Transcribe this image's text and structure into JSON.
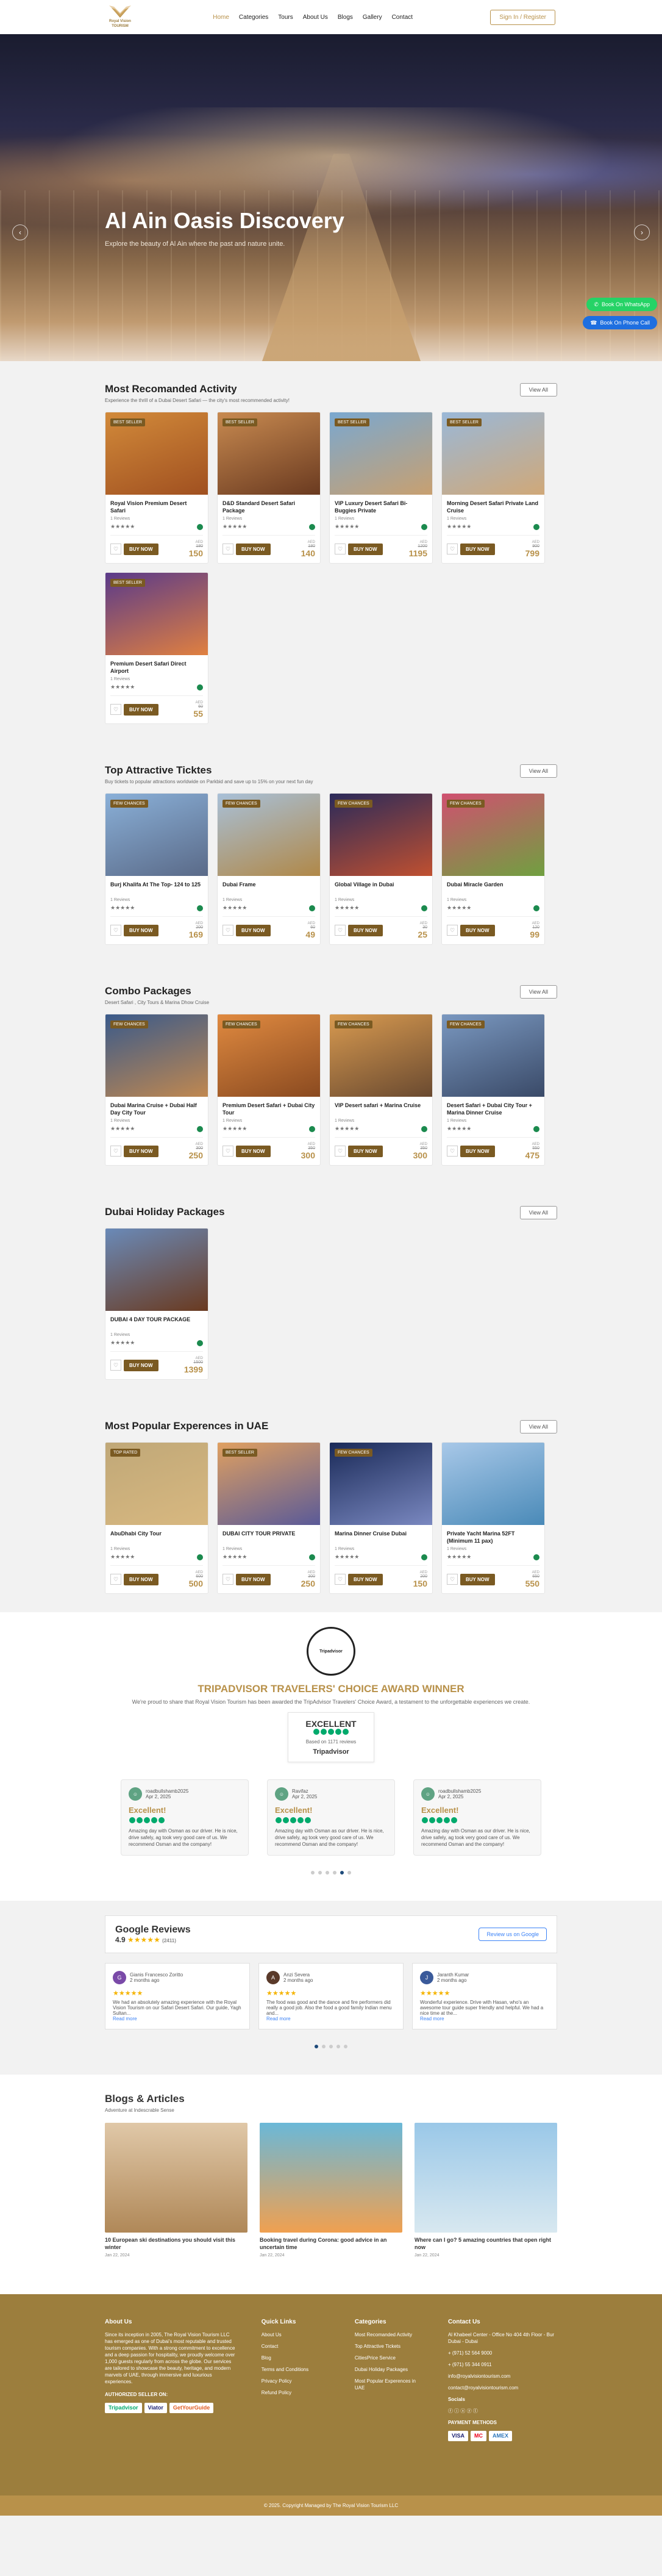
{
  "header": {
    "logo_line1": "Royal Vision",
    "logo_line2": "TOURISM",
    "nav": [
      "Home",
      "Categories",
      "Tours",
      "About Us",
      "Blogs",
      "Gallery",
      "Contact"
    ],
    "signin": "Sign In / Register"
  },
  "hero": {
    "title": "Al Ain Oasis Discovery",
    "subtitle": "Explore the beauty of Al Ain where the past and nature unite.",
    "whatsapp": "Book On WhatsApp",
    "phone": "Book On Phone Call"
  },
  "view_all": "View All",
  "buy": "BUY NOW",
  "aed": "AED",
  "sections": [
    {
      "title": "Most Recomanded Activity",
      "subtitle": "Experience the thrill of a Dubai Desert Safari — the city's most recommended activity!",
      "cards": [
        {
          "badge": "BEST SELLER",
          "title": "Royal Vision Premium Desert Safari",
          "reviews": "1 Reviews",
          "old": "180",
          "price": "150",
          "colors": [
            "#d28a3a",
            "#a05020"
          ]
        },
        {
          "badge": "BEST SELLER",
          "title": "D&D Standard Desert Safari Package",
          "reviews": "1 Reviews",
          "old": "180",
          "price": "140",
          "colors": [
            "#c88a50",
            "#6a3a20"
          ]
        },
        {
          "badge": "BEST SELLER",
          "title": "VIP Luxury Desert Safari Bi-Buggies Private",
          "reviews": "1 Reviews",
          "old": "1200",
          "price": "1195",
          "colors": [
            "#7aa8d0",
            "#c8a070"
          ]
        },
        {
          "badge": "BEST SELLER",
          "title": "Morning Desert Safari Private Land Cruise",
          "reviews": "1 Reviews",
          "old": "900",
          "price": "799",
          "colors": [
            "#9ab8d8",
            "#d0a878"
          ]
        },
        {
          "badge": "BEST SELLER",
          "title": "Premium Desert Safari Direct Airport",
          "reviews": "1 Reviews",
          "old": "60",
          "price": "55",
          "colors": [
            "#5a3a8a",
            "#e08040"
          ]
        }
      ]
    },
    {
      "title": "Top Attractive Ticktes",
      "subtitle": "Buy tickets to popular attractions worldwide on Parkbid and save up to 15% on your next fun day",
      "cards": [
        {
          "badge": "FEW CHANCES",
          "title": "Burj Khalifa At The Top- 124 to 125",
          "reviews": "1 Reviews",
          "old": "200",
          "price": "169",
          "colors": [
            "#8ab0d8",
            "#5a6a88"
          ]
        },
        {
          "badge": "FEW CHANCES",
          "title": "Dubai Frame",
          "reviews": "1 Reviews",
          "old": "60",
          "price": "49",
          "colors": [
            "#a8c0d8",
            "#b08848"
          ]
        },
        {
          "badge": "FEW CHANCES",
          "title": "Global Village in Dubai",
          "reviews": "1 Reviews",
          "old": "30",
          "price": "25",
          "colors": [
            "#2a2a5a",
            "#c05030"
          ]
        },
        {
          "badge": "FEW CHANCES",
          "title": "Dubai Miracle Garden",
          "reviews": "1 Reviews",
          "old": "120",
          "price": "99",
          "colors": [
            "#d05070",
            "#70a040"
          ]
        }
      ]
    },
    {
      "title": "Combo Packages",
      "subtitle": "Desert Safari , City Tours & Marina Dhow Cruise",
      "cards": [
        {
          "badge": "FEW CHANCES",
          "title": "Dubai Marina Cruise + Dubai Half Day City Tour",
          "reviews": "1 Reviews",
          "old": "300",
          "price": "250",
          "colors": [
            "#3a5a8a",
            "#c08850"
          ]
        },
        {
          "badge": "FEW CHANCES",
          "title": "Premium Desert Safari + Dubai City Tour",
          "reviews": "1 Reviews",
          "old": "350",
          "price": "300",
          "colors": [
            "#e08a40",
            "#8a4a20"
          ]
        },
        {
          "badge": "FEW CHANCES",
          "title": "VIP Desert safari + Marina Cruise",
          "reviews": "1 Reviews",
          "old": "350",
          "price": "300",
          "colors": [
            "#d89a50",
            "#6a4a30"
          ]
        },
        {
          "badge": "FEW CHANCES",
          "title": "Desert Safari + Dubai City Tour + Marina Dinner Cruise",
          "reviews": "1 Reviews",
          "old": "550",
          "price": "475",
          "colors": [
            "#7a98c0",
            "#3a4a68"
          ]
        }
      ]
    },
    {
      "title": "Dubai Holiday Packages",
      "subtitle": "",
      "cards": [
        {
          "badge": "",
          "title": "DUBAI 4 DAY TOUR PACKAGE",
          "reviews": "1 Reviews",
          "old": "1500",
          "price": "1399",
          "colors": [
            "#6a8ab8",
            "#6a3a20"
          ]
        }
      ]
    },
    {
      "title": "Most Popular Experences in UAE",
      "subtitle": "",
      "cards": [
        {
          "badge": "TOP RATED",
          "title": "AbuDhabi City Tour",
          "reviews": "1 Reviews",
          "old": "600",
          "price": "500",
          "colors": [
            "#c0a878",
            "#d8b880"
          ]
        },
        {
          "badge": "BEST SELLER",
          "title": "DUBAI CITY TOUR PRIVATE",
          "reviews": "1 Reviews",
          "old": "300",
          "price": "250",
          "colors": [
            "#e0a060",
            "#5a5a98"
          ]
        },
        {
          "badge": "FEW CHANCES",
          "title": "Marina Dinner Cruise Dubai",
          "reviews": "1 Reviews",
          "old": "200",
          "price": "150",
          "colors": [
            "#1a2a58",
            "#7a88c0"
          ]
        },
        {
          "badge": "",
          "title": "Private Yacht Marina 52FT (Minimum 11 pax)",
          "reviews": "1 Reviews",
          "old": "650",
          "price": "550",
          "colors": [
            "#a8c8e8",
            "#4a8ab8"
          ]
        }
      ]
    }
  ],
  "tripadvisor": {
    "medal": "Tripadvisor",
    "title": "TRIPADVISOR TRAVELERS' CHOICE AWARD WINNER",
    "subtitle": "We're proud to share that Royal Vision Tourism has been awarded the TripAdvisor Travelers' Choice Award, a testament to the unforgettable experiences we create.",
    "rating": "EXCELLENT",
    "based": "Based on 1171 reviews",
    "brand": "Tripadvisor",
    "reviews": [
      {
        "user": "roadbullshamb2025",
        "date": "Apr 2, 2025",
        "head": "Excellent!",
        "text": "Amazing day with Osman as our driver. He is nice, drive safely, ag took very good care of us. We recommend Osman and the company!"
      },
      {
        "user": "Ravifaz",
        "date": "Apr 2, 2025",
        "head": "Excellent!",
        "text": "Amazing day with Osman as our driver. He is nice, drive safely, ag took very good care of us. We recommend Osman and the company!"
      },
      {
        "user": "roadbullshamb2025",
        "date": "Apr 2, 2025",
        "head": "Excellent!",
        "text": "Amazing day with Osman as our driver. He is nice, drive safely, ag took very good care of us. We recommend Osman and the company!"
      }
    ]
  },
  "google": {
    "brand": "Google Reviews",
    "rating": "4.9",
    "stars": "★★★★★",
    "count": "(2411)",
    "button": "Review us on Google",
    "reviews": [
      {
        "initial": "G",
        "name": "Gianis Francesco Zoritto",
        "date": "2 months ago",
        "text": "We had an absolutely amazing experience with the Royal Vision Tourism on our Safari Desert Safari. Our guide, Yagh Sultan...",
        "more": "Read more",
        "color": "#7a4aa8"
      },
      {
        "initial": "A",
        "name": "Anzi Severa",
        "date": "2 months ago",
        "text": "The food was good and the dance and fire performers did really a good job. Also the food a good family Indian menu and...",
        "more": "Read more",
        "color": "#5a3a2a"
      },
      {
        "initial": "J",
        "name": "Jaranth Kumar",
        "date": "2 months ago",
        "text": "Wonderful experience. Drive with Hasan, who's an awesome tour guide super friendly and helpful. We had a nice time at the...",
        "more": "Read more",
        "color": "#3a5a9a"
      }
    ]
  },
  "blogs": {
    "title": "Blogs & Articles",
    "subtitle": "Adventure at Indescrable Sense",
    "items": [
      {
        "title": "10 European ski destinations you should visit this winter",
        "date": "Jan 22, 2024",
        "colors": [
          "#e0c8a8",
          "#b08858"
        ]
      },
      {
        "title": "Booking travel during Corona: good advice in an uncertain time",
        "date": "Jan 22, 2024",
        "colors": [
          "#6ab8d8",
          "#f0a050"
        ]
      },
      {
        "title": "Where can I go? 5 amazing countries that open right now",
        "date": "Jan 22, 2024",
        "colors": [
          "#9ac8e8",
          "#d8e8f0"
        ]
      }
    ]
  },
  "footer": {
    "about_h": "About Us",
    "about": "Since its inception in 2005, The Royal Vision Tourism LLC has emerged as one of Dubai's most reputable and trusted tourism companies. With a strong commitment to excellence and a deep passion for hospitality, we proudly welcome over 1,000 guests regularly from across the globe. Our services are tailored to showcase the beauty, heritage, and modern marvels of UAE, through immersive and luxurious experiences.",
    "authorized": "AUTHORIZED SELLER ON:",
    "links_h": "Quick Links",
    "links": [
      "About Us",
      "Contact",
      "Blog",
      "Terms and Conditions",
      "Privacy Policy",
      "Refund Policy"
    ],
    "cat_h": "Categories",
    "cats": [
      "Most Recomanded Activity",
      "Top Attractive Tickets",
      "CitiesPrice Service",
      "Dubai Holiday Packages",
      "Most Popular Experences in UAE"
    ],
    "contact_h": "Contact Us",
    "contacts": [
      "Al Khabeel Center - Office No 404 4th Floor - Bur Dubai - Dubai",
      "+ (971) 52 564 9000",
      "+ (971) 55 344 0911",
      "info@royalvisiontourism.com",
      "contact@royalvisiontourism.com"
    ],
    "social": "Socials",
    "payment": "PAYMENT METHODS",
    "copy": "© 2025. Copyright Managed by The Royal Vision Tourism LLC"
  }
}
